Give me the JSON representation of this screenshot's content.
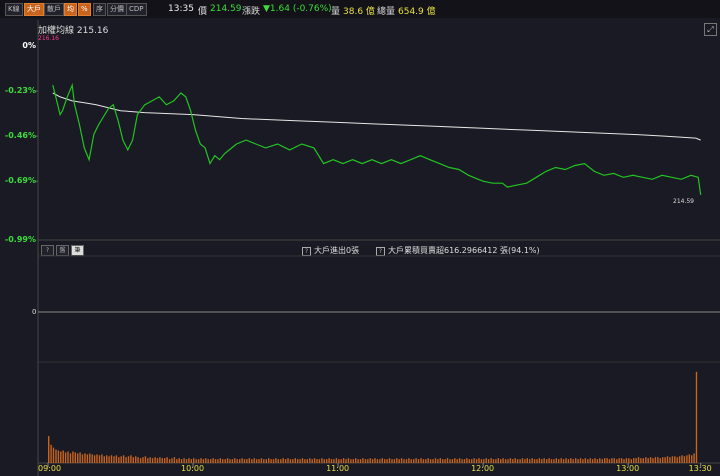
{
  "toolbar": {
    "buttons": [
      {
        "label": "K線",
        "active": false
      },
      {
        "label": "大戶",
        "active": true
      },
      {
        "label": "散戶",
        "active": false
      },
      {
        "label": "均",
        "active": true
      },
      {
        "label": "%",
        "active": true
      },
      {
        "label": "序",
        "active": false
      },
      {
        "label": "分價",
        "active": false
      },
      {
        "label": "CDP",
        "active": false
      }
    ]
  },
  "quote": {
    "time": "13:35",
    "price_label": "價",
    "price": "214.59",
    "change_label": "漲跌",
    "change": "▼1.64 (-0.76%)",
    "volume_label": "量",
    "volume": "38.6 億",
    "total_label": "總量",
    "total": "654.9 億"
  },
  "avg_title": "加權均線 215.16",
  "avg_sub": "216.16",
  "last_price_tag": "214.59",
  "panel_buttons": [
    "?",
    "盤",
    "筆"
  ],
  "panel_text1": "大戶進出0張",
  "panel_text2": "大戶累積買賣超616.2966412 張(94.1%)",
  "colors": {
    "price_line": "#22c322",
    "avg_line": "#e6e6e6",
    "volume_bar": "#c8641e",
    "accent": "#c8641e"
  },
  "chart_data": {
    "type": "line",
    "ylabels": [
      "0%",
      "-0.23%",
      "-0.46%",
      "-0.69%",
      "-0.99%"
    ],
    "ytick_values": [
      0,
      -0.23,
      -0.46,
      -0.69,
      -0.99
    ],
    "ylim": [
      -0.99,
      0
    ],
    "xticks": [
      "09:00",
      "10:00",
      "11:00",
      "12:00",
      "13:00",
      "13:30"
    ],
    "xtick_minutes": [
      0,
      60,
      120,
      180,
      240,
      270
    ],
    "xlim_minutes": [
      0,
      278
    ],
    "price_series": [
      [
        2,
        -0.2
      ],
      [
        3,
        -0.25
      ],
      [
        5,
        -0.35
      ],
      [
        6,
        -0.33
      ],
      [
        8,
        -0.26
      ],
      [
        10,
        -0.2
      ],
      [
        11,
        -0.3
      ],
      [
        13,
        -0.4
      ],
      [
        15,
        -0.52
      ],
      [
        17,
        -0.58
      ],
      [
        19,
        -0.45
      ],
      [
        21,
        -0.4
      ],
      [
        23,
        -0.36
      ],
      [
        25,
        -0.32
      ],
      [
        27,
        -0.3
      ],
      [
        29,
        -0.38
      ],
      [
        31,
        -0.48
      ],
      [
        33,
        -0.53
      ],
      [
        35,
        -0.48
      ],
      [
        37,
        -0.35
      ],
      [
        40,
        -0.3
      ],
      [
        43,
        -0.28
      ],
      [
        46,
        -0.26
      ],
      [
        49,
        -0.3
      ],
      [
        52,
        -0.28
      ],
      [
        55,
        -0.24
      ],
      [
        57,
        -0.26
      ],
      [
        59,
        -0.33
      ],
      [
        61,
        -0.43
      ],
      [
        63,
        -0.5
      ],
      [
        65,
        -0.52
      ],
      [
        67,
        -0.6
      ],
      [
        69,
        -0.56
      ],
      [
        71,
        -0.58
      ],
      [
        73,
        -0.55
      ],
      [
        75,
        -0.53
      ],
      [
        78,
        -0.5
      ],
      [
        82,
        -0.48
      ],
      [
        86,
        -0.5
      ],
      [
        90,
        -0.52
      ],
      [
        95,
        -0.5
      ],
      [
        100,
        -0.53
      ],
      [
        105,
        -0.5
      ],
      [
        110,
        -0.52
      ],
      [
        114,
        -0.6
      ],
      [
        118,
        -0.58
      ],
      [
        122,
        -0.6
      ],
      [
        126,
        -0.58
      ],
      [
        130,
        -0.6
      ],
      [
        134,
        -0.58
      ],
      [
        138,
        -0.6
      ],
      [
        142,
        -0.58
      ],
      [
        146,
        -0.6
      ],
      [
        150,
        -0.58
      ],
      [
        154,
        -0.56
      ],
      [
        158,
        -0.58
      ],
      [
        162,
        -0.6
      ],
      [
        166,
        -0.62
      ],
      [
        170,
        -0.63
      ],
      [
        174,
        -0.66
      ],
      [
        178,
        -0.68
      ],
      [
        180,
        -0.69
      ],
      [
        184,
        -0.7
      ],
      [
        188,
        -0.7
      ],
      [
        190,
        -0.72
      ],
      [
        194,
        -0.71
      ],
      [
        198,
        -0.7
      ],
      [
        202,
        -0.67
      ],
      [
        206,
        -0.64
      ],
      [
        210,
        -0.62
      ],
      [
        214,
        -0.63
      ],
      [
        218,
        -0.61
      ],
      [
        222,
        -0.6
      ],
      [
        226,
        -0.64
      ],
      [
        230,
        -0.66
      ],
      [
        234,
        -0.65
      ],
      [
        238,
        -0.67
      ],
      [
        242,
        -0.66
      ],
      [
        246,
        -0.67
      ],
      [
        250,
        -0.68
      ],
      [
        254,
        -0.66
      ],
      [
        258,
        -0.67
      ],
      [
        262,
        -0.68
      ],
      [
        266,
        -0.66
      ],
      [
        269,
        -0.67
      ],
      [
        270,
        -0.76
      ]
    ],
    "avg_series": [
      [
        2,
        -0.24
      ],
      [
        5,
        -0.26
      ],
      [
        10,
        -0.28
      ],
      [
        15,
        -0.29
      ],
      [
        20,
        -0.3
      ],
      [
        30,
        -0.33
      ],
      [
        40,
        -0.34
      ],
      [
        60,
        -0.35
      ],
      [
        80,
        -0.37
      ],
      [
        100,
        -0.38
      ],
      [
        120,
        -0.39
      ],
      [
        140,
        -0.4
      ],
      [
        160,
        -0.41
      ],
      [
        180,
        -0.42
      ],
      [
        200,
        -0.43
      ],
      [
        220,
        -0.44
      ],
      [
        240,
        -0.45
      ],
      [
        255,
        -0.46
      ],
      [
        268,
        -0.47
      ],
      [
        270,
        -0.48
      ]
    ],
    "volume_ylabel": "0",
    "volume_max": 100,
    "volume_values": [
      28,
      19,
      16,
      14,
      13,
      12,
      13,
      11,
      12,
      10,
      12,
      11,
      10,
      11,
      9,
      10,
      9,
      10,
      9,
      8,
      9,
      8,
      9,
      7,
      8,
      7,
      8,
      7,
      8,
      6,
      7,
      8,
      6,
      7,
      8,
      6,
      7,
      6,
      5,
      6,
      7,
      5,
      6,
      5,
      6,
      5,
      6,
      5,
      5,
      6,
      4,
      5,
      6,
      4,
      5,
      4,
      5,
      4,
      5,
      4,
      5,
      4,
      4,
      5,
      4,
      5,
      4,
      4,
      5,
      4,
      4,
      5,
      4,
      4,
      5,
      4,
      4,
      5,
      4,
      4,
      5,
      4,
      4,
      5,
      4,
      5,
      4,
      4,
      5,
      4,
      4,
      5,
      4,
      4,
      5,
      4,
      4,
      5,
      4,
      5,
      4,
      4,
      5,
      4,
      4,
      5,
      4,
      4,
      5,
      4,
      5,
      4,
      4,
      5,
      4,
      4,
      5,
      4,
      4,
      5,
      4,
      4,
      5,
      4,
      5,
      4,
      4,
      5,
      4,
      4,
      5,
      4,
      4,
      5,
      4,
      5,
      4,
      4,
      5,
      4,
      4,
      5,
      4,
      4,
      5,
      4,
      5,
      4,
      4,
      5,
      4,
      4,
      5,
      4,
      5,
      4,
      4,
      5,
      4,
      4,
      5,
      4,
      5,
      4,
      4,
      5,
      4,
      4,
      5,
      4,
      5,
      4,
      4,
      5,
      4,
      4,
      5,
      4,
      5,
      4,
      4,
      5,
      4,
      5,
      4,
      4,
      5,
      4,
      5,
      4,
      4,
      5,
      4,
      5,
      4,
      4,
      5,
      4,
      5,
      4,
      5,
      4,
      4,
      5,
      4,
      5,
      4,
      5,
      4,
      4,
      5,
      4,
      5,
      4,
      5,
      4,
      5,
      4,
      5,
      4,
      5,
      4,
      5,
      4,
      5,
      4,
      5,
      4,
      5,
      4,
      5,
      5,
      4,
      5,
      5,
      4,
      5,
      5,
      4,
      5,
      5,
      4,
      5,
      5,
      6,
      5,
      5,
      6,
      5,
      6,
      5,
      6,
      6,
      5,
      6,
      6,
      7,
      6,
      7,
      7,
      6,
      7,
      8,
      7,
      8,
      9,
      8,
      10,
      95
    ]
  }
}
